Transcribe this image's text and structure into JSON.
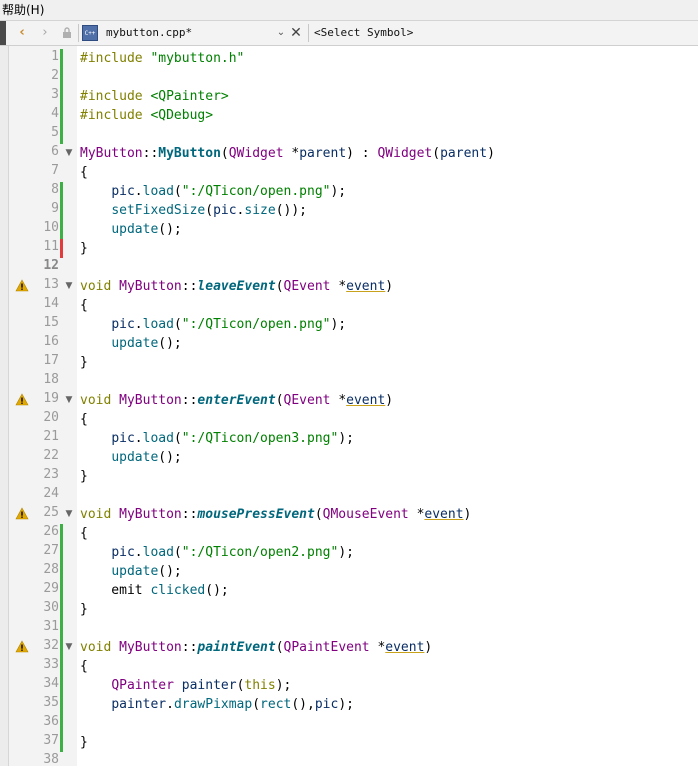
{
  "menu": {
    "help_label": "帮助(H)"
  },
  "toolbar": {
    "back_icon": "‹",
    "forward_icon": "›",
    "lock_icon": "🔒",
    "file_icon_text": "C++",
    "file_name": "mybutton.cpp*",
    "dropdown_icon": "⌄",
    "close_icon": "✕",
    "symbol_label": "<Select Symbol>"
  },
  "colors": {
    "change_mark": "#3cb043",
    "unsaved_mark": "#e23b3b",
    "warning": "#e0a800"
  },
  "lines": [
    {
      "n": "1",
      "mark": "green",
      "tokens": [
        [
          "pp",
          "#include "
        ],
        [
          "str",
          "\"mybutton.h\""
        ]
      ]
    },
    {
      "n": "2",
      "mark": "green",
      "tokens": []
    },
    {
      "n": "3",
      "mark": "green",
      "tokens": [
        [
          "pp",
          "#include "
        ],
        [
          "str",
          "<QPainter>"
        ]
      ]
    },
    {
      "n": "4",
      "mark": "green",
      "tokens": [
        [
          "pp",
          "#include "
        ],
        [
          "str",
          "<QDebug>"
        ]
      ]
    },
    {
      "n": "5",
      "mark": "green",
      "tokens": []
    },
    {
      "n": "6",
      "fold": true,
      "tokens": [
        [
          "cls",
          "MyButton"
        ],
        [
          "",
          "::"
        ],
        [
          "fnb",
          "MyButton"
        ],
        [
          "",
          "("
        ],
        [
          "cls",
          "QWidget"
        ],
        [
          "",
          " *"
        ],
        [
          "var",
          "parent"
        ],
        [
          "",
          ") : "
        ],
        [
          "cls",
          "QWidget"
        ],
        [
          "",
          "("
        ],
        [
          "var",
          "parent"
        ],
        [
          "",
          ")"
        ]
      ]
    },
    {
      "n": "7",
      "tokens": [
        [
          "",
          "{"
        ]
      ]
    },
    {
      "n": "8",
      "mark": "green",
      "tokens": [
        [
          "",
          "    "
        ],
        [
          "var",
          "pic"
        ],
        [
          "",
          "."
        ],
        [
          "fn",
          "load"
        ],
        [
          "",
          "("
        ],
        [
          "str",
          "\":/QTicon/open.png\""
        ],
        [
          "",
          ");"
        ]
      ]
    },
    {
      "n": "9",
      "mark": "green",
      "tokens": [
        [
          "",
          "    "
        ],
        [
          "fn",
          "setFixedSize"
        ],
        [
          "",
          "("
        ],
        [
          "var",
          "pic"
        ],
        [
          "",
          "."
        ],
        [
          "fn",
          "size"
        ],
        [
          "",
          "());"
        ]
      ]
    },
    {
      "n": "10",
      "mark": "green",
      "tokens": [
        [
          "",
          "    "
        ],
        [
          "fn",
          "update"
        ],
        [
          "",
          "();"
        ]
      ]
    },
    {
      "n": "11",
      "mark": "red",
      "tokens": [
        [
          "",
          "}"
        ]
      ]
    },
    {
      "n": "12",
      "cur": true,
      "tokens": []
    },
    {
      "n": "13",
      "warn": true,
      "fold": true,
      "tokens": [
        [
          "kw",
          "void "
        ],
        [
          "cls",
          "MyButton"
        ],
        [
          "",
          "::"
        ],
        [
          "fni",
          "leaveEvent"
        ],
        [
          "",
          "("
        ],
        [
          "cls",
          "QEvent"
        ],
        [
          "",
          " *"
        ],
        [
          "evt",
          "event"
        ],
        [
          "",
          ")"
        ]
      ]
    },
    {
      "n": "14",
      "tokens": [
        [
          "",
          "{"
        ]
      ]
    },
    {
      "n": "15",
      "tokens": [
        [
          "",
          "    "
        ],
        [
          "var",
          "pic"
        ],
        [
          "",
          "."
        ],
        [
          "fn",
          "load"
        ],
        [
          "",
          "("
        ],
        [
          "str",
          "\":/QTicon/open.png\""
        ],
        [
          "",
          ");"
        ]
      ]
    },
    {
      "n": "16",
      "tokens": [
        [
          "",
          "    "
        ],
        [
          "fn",
          "update"
        ],
        [
          "",
          "();"
        ]
      ]
    },
    {
      "n": "17",
      "tokens": [
        [
          "",
          "}"
        ]
      ]
    },
    {
      "n": "18",
      "tokens": []
    },
    {
      "n": "19",
      "warn": true,
      "fold": true,
      "tokens": [
        [
          "kw",
          "void "
        ],
        [
          "cls",
          "MyButton"
        ],
        [
          "",
          "::"
        ],
        [
          "fni",
          "enterEvent"
        ],
        [
          "",
          "("
        ],
        [
          "cls",
          "QEvent"
        ],
        [
          "",
          " *"
        ],
        [
          "evt",
          "event"
        ],
        [
          "",
          ")"
        ]
      ]
    },
    {
      "n": "20",
      "tokens": [
        [
          "",
          "{"
        ]
      ]
    },
    {
      "n": "21",
      "tokens": [
        [
          "",
          "    "
        ],
        [
          "var",
          "pic"
        ],
        [
          "",
          "."
        ],
        [
          "fn",
          "load"
        ],
        [
          "",
          "("
        ],
        [
          "str",
          "\":/QTicon/open3.png\""
        ],
        [
          "",
          ");"
        ]
      ]
    },
    {
      "n": "22",
      "tokens": [
        [
          "",
          "    "
        ],
        [
          "fn",
          "update"
        ],
        [
          "",
          "();"
        ]
      ]
    },
    {
      "n": "23",
      "tokens": [
        [
          "",
          "}"
        ]
      ]
    },
    {
      "n": "24",
      "tokens": []
    },
    {
      "n": "25",
      "warn": true,
      "fold": true,
      "tokens": [
        [
          "kw",
          "void "
        ],
        [
          "cls",
          "MyButton"
        ],
        [
          "",
          "::"
        ],
        [
          "fni",
          "mousePressEvent"
        ],
        [
          "",
          "("
        ],
        [
          "cls",
          "QMouseEvent"
        ],
        [
          "",
          " *"
        ],
        [
          "evt",
          "event"
        ],
        [
          "",
          ")"
        ]
      ]
    },
    {
      "n": "26",
      "mark": "green",
      "tokens": [
        [
          "",
          "{"
        ]
      ]
    },
    {
      "n": "27",
      "mark": "green",
      "tokens": [
        [
          "",
          "    "
        ],
        [
          "var",
          "pic"
        ],
        [
          "",
          "."
        ],
        [
          "fn",
          "load"
        ],
        [
          "",
          "("
        ],
        [
          "str",
          "\":/QTicon/open2.png\""
        ],
        [
          "",
          ");"
        ]
      ]
    },
    {
      "n": "28",
      "mark": "green",
      "tokens": [
        [
          "",
          "    "
        ],
        [
          "fn",
          "update"
        ],
        [
          "",
          "();"
        ]
      ]
    },
    {
      "n": "29",
      "mark": "green",
      "tokens": [
        [
          "",
          "    emit "
        ],
        [
          "fn",
          "clicked"
        ],
        [
          "",
          "();"
        ]
      ]
    },
    {
      "n": "30",
      "mark": "green",
      "tokens": [
        [
          "",
          "}"
        ]
      ]
    },
    {
      "n": "31",
      "mark": "green",
      "tokens": []
    },
    {
      "n": "32",
      "warn": true,
      "fold": true,
      "mark": "green",
      "tokens": [
        [
          "kw",
          "void "
        ],
        [
          "cls",
          "MyButton"
        ],
        [
          "",
          "::"
        ],
        [
          "fni",
          "paintEvent"
        ],
        [
          "",
          "("
        ],
        [
          "cls",
          "QPaintEvent"
        ],
        [
          "",
          " *"
        ],
        [
          "evt",
          "event"
        ],
        [
          "",
          ")"
        ]
      ]
    },
    {
      "n": "33",
      "mark": "green",
      "tokens": [
        [
          "",
          "{"
        ]
      ]
    },
    {
      "n": "34",
      "mark": "green",
      "tokens": [
        [
          "",
          "    "
        ],
        [
          "cls",
          "QPainter"
        ],
        [
          "",
          " "
        ],
        [
          "var",
          "painter"
        ],
        [
          "",
          "("
        ],
        [
          "kw",
          "this"
        ],
        [
          "",
          ");"
        ]
      ]
    },
    {
      "n": "35",
      "mark": "green",
      "tokens": [
        [
          "",
          "    "
        ],
        [
          "var",
          "painter"
        ],
        [
          "",
          "."
        ],
        [
          "fn",
          "drawPixmap"
        ],
        [
          "",
          "("
        ],
        [
          "fn",
          "rect"
        ],
        [
          "",
          "(),"
        ],
        [
          "var",
          "pic"
        ],
        [
          "",
          ");"
        ]
      ]
    },
    {
      "n": "36",
      "mark": "green",
      "tokens": []
    },
    {
      "n": "37",
      "mark": "green",
      "tokens": [
        [
          "",
          "}"
        ]
      ]
    },
    {
      "n": "38",
      "tokens": []
    }
  ]
}
